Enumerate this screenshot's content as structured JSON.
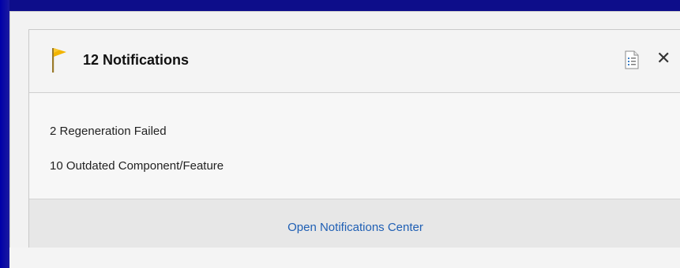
{
  "popup": {
    "title": "12 Notifications",
    "items": [
      "2 Regeneration Failed",
      "10 Outdated Component/Feature"
    ],
    "footer_link": "Open Notifications Center",
    "close_glyph": "✕"
  },
  "icons": {
    "flag": "flag-icon",
    "list": "list-view-icon",
    "close": "close-icon"
  },
  "colors": {
    "background_blue": "#0b0b8f",
    "flag_yellow": "#f2b400",
    "link_blue": "#1f5fb4"
  }
}
